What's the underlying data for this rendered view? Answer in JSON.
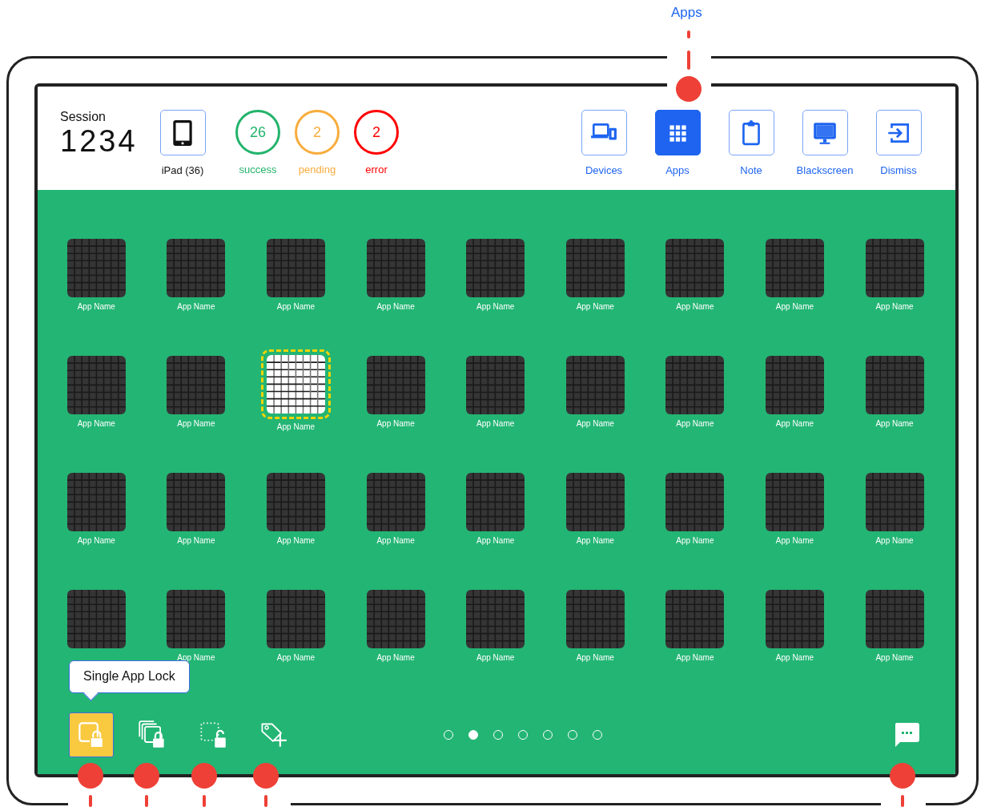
{
  "callout": {
    "label": "Apps"
  },
  "header": {
    "session_label": "Session",
    "session_number": "1234",
    "device": {
      "label": "iPad (36)"
    },
    "statuses": [
      {
        "count": "26",
        "label": "success",
        "color": "#22b36b"
      },
      {
        "count": "2",
        "label": "pending",
        "color": "#f8ac3c"
      },
      {
        "count": "2",
        "label": "error",
        "color": "#ff0000"
      }
    ],
    "nav": [
      {
        "kind": "devices",
        "label": "Devices",
        "selected": false
      },
      {
        "kind": "apps",
        "label": "Apps",
        "selected": true
      },
      {
        "kind": "note",
        "label": "Note",
        "selected": false
      },
      {
        "kind": "blackscreen",
        "label": "Blackscreen",
        "selected": false
      },
      {
        "kind": "dismiss",
        "label": "Dismiss",
        "selected": false
      }
    ]
  },
  "apps": [
    {
      "label": "App Name",
      "selected": false
    },
    {
      "label": "App Name",
      "selected": false
    },
    {
      "label": "App Name",
      "selected": false
    },
    {
      "label": "App Name",
      "selected": false
    },
    {
      "label": "App Name",
      "selected": false
    },
    {
      "label": "App Name",
      "selected": false
    },
    {
      "label": "App Name",
      "selected": false
    },
    {
      "label": "App Name",
      "selected": false
    },
    {
      "label": "App Name",
      "selected": false
    },
    {
      "label": "App Name",
      "selected": false
    },
    {
      "label": "App Name",
      "selected": false
    },
    {
      "label": "App Name",
      "selected": true
    },
    {
      "label": "App Name",
      "selected": false
    },
    {
      "label": "App Name",
      "selected": false
    },
    {
      "label": "App Name",
      "selected": false
    },
    {
      "label": "App Name",
      "selected": false
    },
    {
      "label": "App Name",
      "selected": false
    },
    {
      "label": "App Name",
      "selected": false
    },
    {
      "label": "App Name",
      "selected": false
    },
    {
      "label": "App Name",
      "selected": false
    },
    {
      "label": "App Name",
      "selected": false
    },
    {
      "label": "App Name",
      "selected": false
    },
    {
      "label": "App Name",
      "selected": false
    },
    {
      "label": "App Name",
      "selected": false
    },
    {
      "label": "App Name",
      "selected": false
    },
    {
      "label": "App Name",
      "selected": false
    },
    {
      "label": "App Name",
      "selected": false
    },
    {
      "selected": false
    },
    {
      "label": "App Name",
      "selected": false
    },
    {
      "label": "App Name",
      "selected": false
    },
    {
      "label": "App Name",
      "selected": false
    },
    {
      "label": "App Name",
      "selected": false
    },
    {
      "label": "App Name",
      "selected": false
    },
    {
      "label": "App Name",
      "selected": false
    },
    {
      "label": "App Name",
      "selected": false
    },
    {
      "label": "App Name",
      "selected": false
    }
  ],
  "toolbar": {
    "tooltip": "Single App Lock",
    "tools": [
      {
        "kind": "single-lock",
        "selected": true
      },
      {
        "kind": "multi-lock",
        "selected": false
      },
      {
        "kind": "unlock",
        "selected": false
      },
      {
        "kind": "tag-add",
        "selected": false
      }
    ]
  },
  "pager": [
    {
      "selected": false
    },
    {
      "selected": true
    },
    {
      "selected": false
    },
    {
      "selected": false
    },
    {
      "selected": false
    },
    {
      "selected": false
    },
    {
      "selected": false
    }
  ]
}
